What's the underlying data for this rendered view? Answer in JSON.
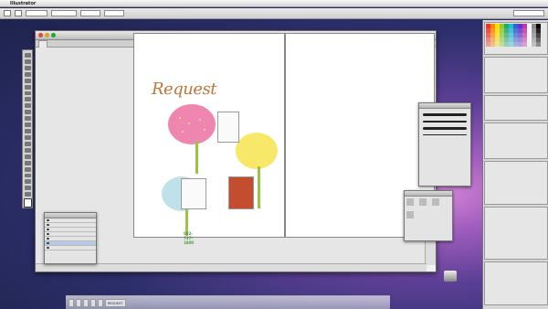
{
  "menubar": {
    "app_name": "Illustrator"
  },
  "document": {
    "title": "REQUEST"
  },
  "artwork": {
    "title": "Request",
    "telephone": "092-737-1800"
  },
  "dock": {
    "items": [
      "REQUEST"
    ]
  },
  "colors": {
    "flower_pink": "#ef86b0",
    "flower_yellow": "#f7e86a",
    "flower_blue": "#bfe2ea",
    "stem_green": "#9cc346",
    "title_brown": "#c0763a"
  }
}
